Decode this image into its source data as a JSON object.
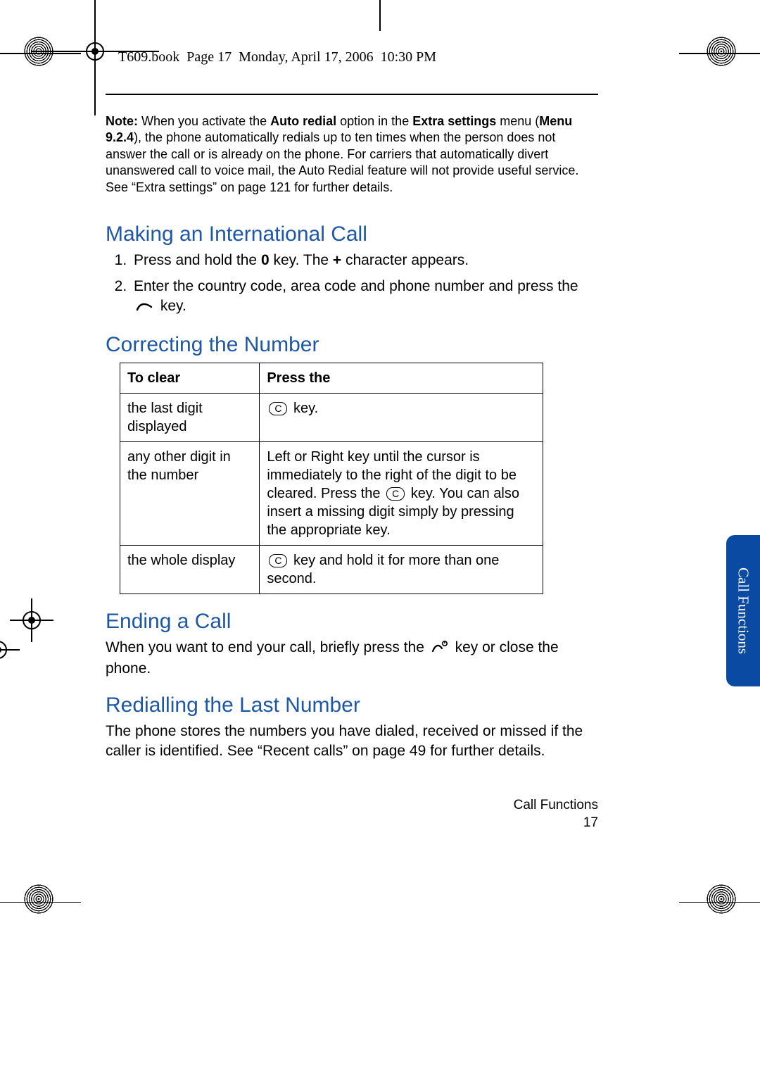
{
  "runhead": "T609.book  Page 17  Monday, April 17, 2006  10:30 PM",
  "note": {
    "prefix": "Note:",
    "t1": " When you activate the ",
    "b1": "Auto redial",
    "t2": " option in the ",
    "b2": "Extra settings",
    "t3": " menu (",
    "b3": "Menu 9.2.4",
    "t4": "), the phone automatically redials up to ten times when the person does not answer the call or is already on the phone. For carriers that automatically divert unanswered call to voice mail, the Auto Redial feature will not provide useful service. See “Extra settings” on page 121 for further details."
  },
  "h_intl": "Making an International Call",
  "intl_steps": {
    "s1a": "Press and hold the ",
    "s1_key0": "0",
    "s1b": " key. The ",
    "s1_plus": "+",
    "s1c": " character appears.",
    "s2a": "Enter the country code, area code and phone number and press the ",
    "s2b": " key."
  },
  "h_corr": "Correcting the Number",
  "table": {
    "h1": "To clear",
    "h2": "Press the",
    "r1c1": "the last digit displayed",
    "r1c2": " key.",
    "r2c1": "any other digit in the number",
    "r2c2a": "Left or Right key until the cursor is immediately to the right of the digit to be cleared. Press the ",
    "r2c2b": " key. You can also insert a missing digit simply by pressing the appropriate key.",
    "r3c1": "the whole display",
    "r3c2": " key and hold it for more than one second."
  },
  "h_end": "Ending a Call",
  "end_body_a": "When you want to end your call, briefly press the ",
  "end_body_b": " key or close the phone.",
  "h_redial": "Redialling the Last Number",
  "redial_body": "The phone stores the numbers you have dialed, received or missed if the caller is identified. See “Recent calls” on page 49 for further details.",
  "footer_section": "Call Functions",
  "footer_page": "17",
  "sidetab": "Call Functions",
  "ckey_label": "C"
}
